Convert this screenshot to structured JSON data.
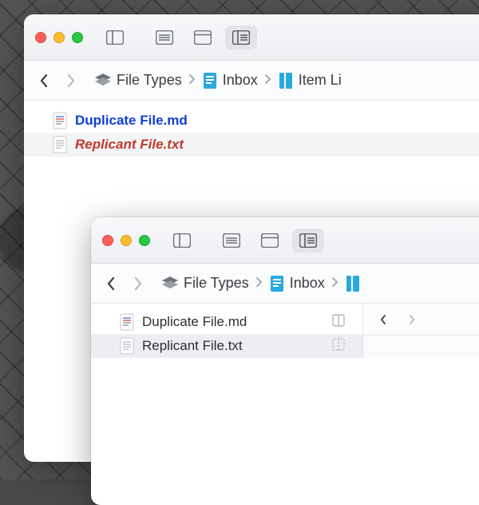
{
  "back": {
    "breadcrumb": {
      "root": "File Types",
      "inbox": "Inbox",
      "last": "Item Li"
    },
    "files": [
      {
        "name": "Duplicate File.md",
        "style": "blue"
      },
      {
        "name": "Replicant File.txt",
        "style": "red"
      }
    ]
  },
  "front": {
    "breadcrumb": {
      "root": "File Types",
      "inbox": "Inbox"
    },
    "files": [
      {
        "name": "Duplicate File.md"
      },
      {
        "name": "Replicant File.txt"
      }
    ]
  },
  "colors": {
    "accent_blue": "#0e3fd4",
    "accent_red": "#c23a2a",
    "inbox_icon": "#2aa8e0"
  }
}
